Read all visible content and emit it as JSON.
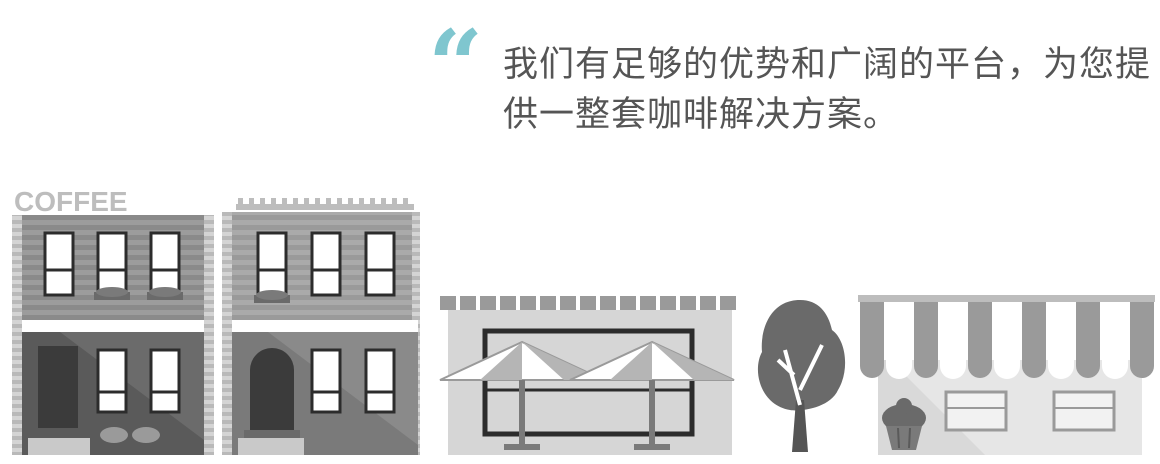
{
  "quote": {
    "mark": "“",
    "text": "我们有足够的优势和广阔的平台，为您提供一整套咖啡解决方案。"
  },
  "scene": {
    "sign": "COFFEE"
  },
  "colors": {
    "accent": "#7fc6cf",
    "text": "#555555",
    "building_light": "#9a9a9a",
    "building_dark": "#5f5f5f",
    "white": "#ffffff"
  },
  "icons": [
    "quote-icon",
    "building-icon",
    "umbrella-icon",
    "tree-icon",
    "awning-icon",
    "cupcake-icon"
  ]
}
